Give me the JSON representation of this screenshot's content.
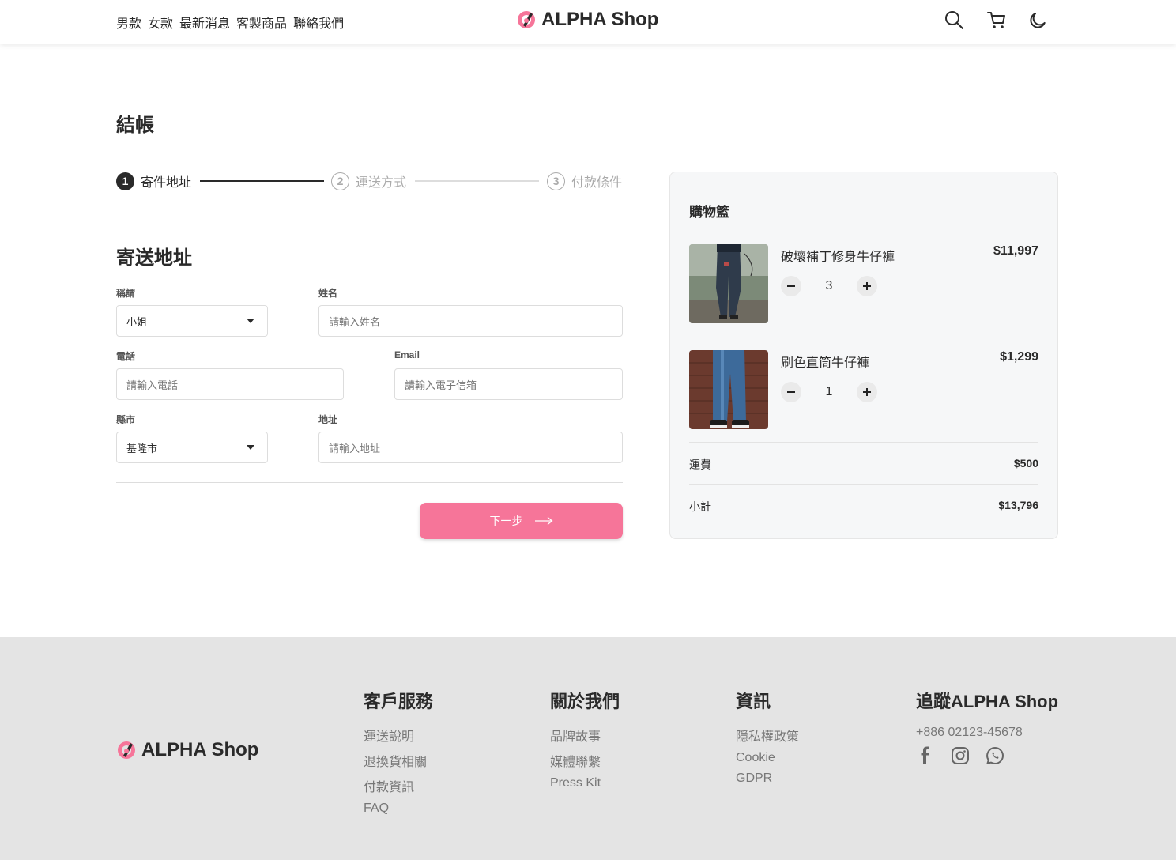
{
  "header": {
    "nav": [
      "男款",
      "女款",
      "最新消息",
      "客製商品",
      "聯絡我們"
    ],
    "brand": "ALPHA Shop",
    "icons": [
      "search-icon",
      "cart-icon",
      "moon-icon"
    ]
  },
  "page": {
    "title": "結帳"
  },
  "stepper": {
    "steps": [
      {
        "num": "1",
        "label": "寄件地址"
      },
      {
        "num": "2",
        "label": "運送方式"
      },
      {
        "num": "3",
        "label": "付款條件"
      }
    ]
  },
  "form": {
    "section_title": "寄送地址",
    "salutation": {
      "label": "稱謂",
      "value": "小姐"
    },
    "name": {
      "label": "姓名",
      "placeholder": "請輸入姓名"
    },
    "phone": {
      "label": "電話",
      "placeholder": "請輸入電話"
    },
    "email": {
      "label": "Email",
      "placeholder": "請輸入電子信箱"
    },
    "city": {
      "label": "縣市",
      "value": "基隆市"
    },
    "address": {
      "label": "地址",
      "placeholder": "請輸入地址"
    },
    "next_label": "下一步"
  },
  "cart": {
    "title": "購物籃",
    "items": [
      {
        "name": "破壞補丁修身牛仔褲",
        "price": "$11,997",
        "qty": "3"
      },
      {
        "name": "刷色直筒牛仔褲",
        "price": "$1,299",
        "qty": "1"
      }
    ],
    "shipping_label": "運費",
    "shipping_value": "$500",
    "subtotal_label": "小計",
    "subtotal_value": "$13,796"
  },
  "footer": {
    "brand": "ALPHA Shop",
    "service": {
      "title": "客戶服務",
      "links": [
        "運送說明",
        "退換貨相關",
        "付款資訊",
        "FAQ"
      ]
    },
    "about": {
      "title": "關於我們",
      "links": [
        "品牌故事",
        "媒體聯繫",
        "Press Kit"
      ]
    },
    "info": {
      "title": "資訊",
      "links": [
        "隱私權政策",
        "Cookie",
        "GDPR"
      ]
    },
    "follow": {
      "title": "追蹤ALPHA Shop",
      "phone": "+886 02123-45678",
      "icons": [
        "facebook-icon",
        "instagram-icon",
        "whatsapp-icon"
      ]
    }
  },
  "colors": {
    "accent": "#f67599",
    "dark": "#2a2a2a",
    "footer_bg": "#e4e4e4",
    "cart_bg": "#f6f7f8"
  }
}
